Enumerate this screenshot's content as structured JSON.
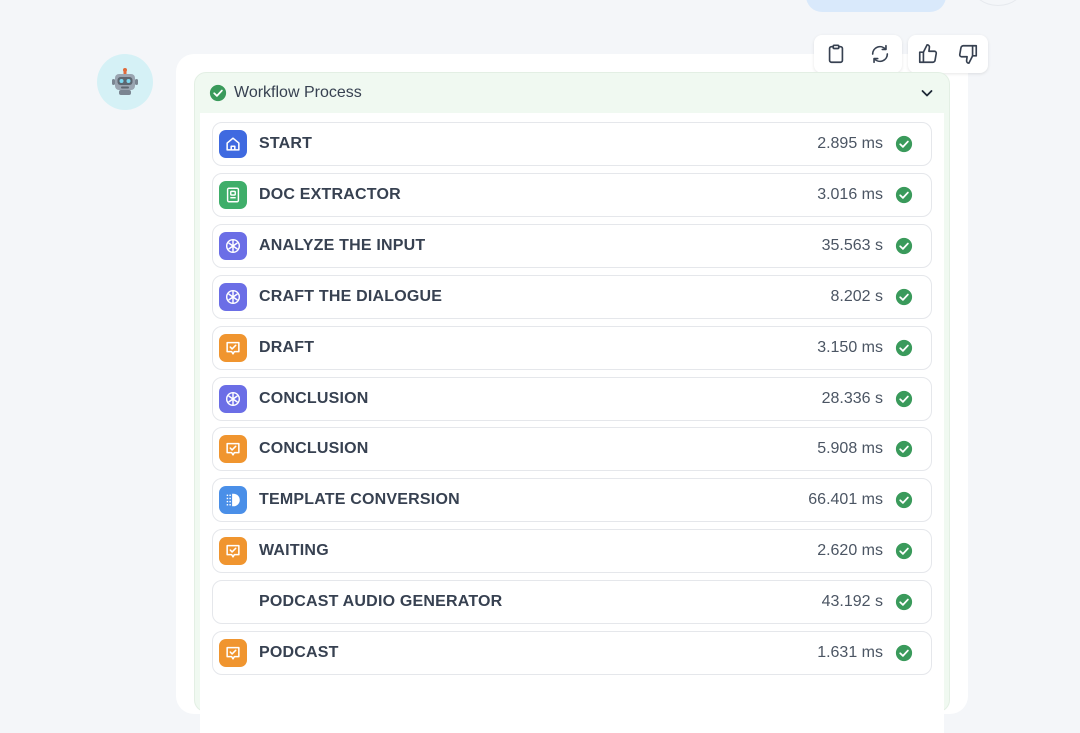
{
  "workflow": {
    "title": "Workflow Process",
    "status": "success"
  },
  "actions": [
    "clipboard-icon",
    "refresh-icon",
    "thumbs-up-icon",
    "thumbs-down-icon"
  ],
  "colors": {
    "success": "#3a9a5b",
    "start": "#3f6ae0",
    "doc": "#3fae6a",
    "llm": "#6b6ee6",
    "answer": "#f0952f",
    "template": "#4a8fe8",
    "header_bg": "#f0f9f1",
    "avatar_bg": "#d5f1f6"
  },
  "nodes": [
    {
      "name": "START",
      "time": "2.895 ms",
      "icon": "home-icon"
    },
    {
      "name": "DOC EXTRACTOR",
      "time": "3.016 ms",
      "icon": "document-icon"
    },
    {
      "name": "ANALYZE THE INPUT",
      "time": "35.563 s",
      "icon": "llm-icon"
    },
    {
      "name": "CRAFT THE DIALOGUE",
      "time": "8.202 s",
      "icon": "llm-icon"
    },
    {
      "name": "DRAFT",
      "time": "3.150 ms",
      "icon": "answer-icon"
    },
    {
      "name": "CONCLUSION",
      "time": "28.336 s",
      "icon": "llm-icon"
    },
    {
      "name": "CONCLUSION",
      "time": "5.908 ms",
      "icon": "answer-icon"
    },
    {
      "name": "TEMPLATE CONVERSION",
      "time": "66.401 ms",
      "icon": "template-icon"
    },
    {
      "name": "WAITING",
      "time": "2.620 ms",
      "icon": "answer-icon"
    },
    {
      "name": "PODCAST AUDIO GENERATOR",
      "time": "43.192 s",
      "icon": "blank-icon"
    },
    {
      "name": "PODCAST",
      "time": "1.631 ms",
      "icon": "answer-icon"
    }
  ]
}
